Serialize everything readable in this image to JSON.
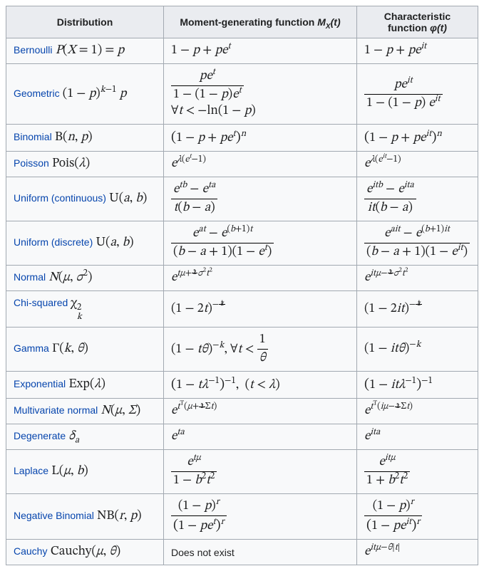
{
  "headers": {
    "dist": "Distribution",
    "mgf_pre": "Moment-generating function ",
    "mgf_sym": "M",
    "mgf_sub": "X",
    "mgf_arg": "(t)",
    "cf_pre": "Characteristic function ",
    "cf_sym": "φ(t)"
  },
  "rows": [
    {
      "link": "Bernoulli",
      "notation": " <span class='mi'>P</span>(<span class='mi'>X</span> = 1) = <span class='mi'>p</span>",
      "mgf": "1 − <span class='mi'>p</span> + <span class='mi'>p</span><span class='mi'>e</span><sup><span class='mi'>t</span></sup>",
      "cf": "1 − <span class='mi'>p</span> + <span class='mi'>p</span><span class='mi'>e</span><sup><span class='mi'>it</span></sup>"
    },
    {
      "link": "Geometric",
      "notation": " (1 − <span class='mi'>p</span>)<sup><span class='mi'>k</span>−1</sup> <span class='mi'>p</span>",
      "mgf": "<span class='frac'><span class='num'><span class='mi'>p</span><span class='mi'>e</span><sup><span class='mi'>t</span></sup></span><span class='den'>1 − (1 − <span class='mi'>p</span>)<span class='mi'>e</span><sup><span class='mi'>t</span></sup></span></span><br>∀<span class='mi'>t</span> &lt; −ln(1 − <span class='mi'>p</span>)",
      "cf": "<span class='frac'><span class='num'><span class='mi'>p</span><span class='mi'>e</span><sup><span class='mi'>it</span></sup></span><span class='den'>1 − (1 − <span class='mi'>p</span>) <span class='mi'>e</span><sup><span class='mi'>it</span></sup></span></span>"
    },
    {
      "link": "Binomial",
      "notation": " B(<span class='it'>n</span>, <span class='it'>p</span>)",
      "mgf": "<span class='bigp'>(</span>1 − <span class='mi'>p</span> + <span class='mi'>p</span><span class='mi'>e</span><sup><span class='mi'>t</span></sup><span class='bigp'>)</span><sup><span class='mi'>n</span></sup>",
      "cf": "<span class='bigp'>(</span>1 − <span class='mi'>p</span> + <span class='mi'>p</span><span class='mi'>e</span><sup><span class='mi'>it</span></sup><span class='bigp'>)</span><sup><span class='mi'>n</span></sup>"
    },
    {
      "link": "Poisson",
      "notation": " Pois(<span class='it'>λ</span>)",
      "mgf": "<span class='mi'>e</span><sup><span class='mi'>λ</span>(<span class='mi'>e</span><sup><span class='mi'>t</span></sup>−1)</sup>",
      "cf": "<span class='mi'>e</span><sup><span class='mi'>λ</span>(<span class='mi'>e</span><sup><span class='mi'>it</span></sup>−1)</sup>"
    },
    {
      "link": "Uniform (continuous)",
      "notation": " U(<span class='it'>a</span>, <span class='it'>b</span>)",
      "mgf": "<span class='frac'><span class='num'><span class='mi'>e</span><sup><span class='mi'>tb</span></sup> − <span class='mi'>e</span><sup><span class='mi'>ta</span></sup></span><span class='den'><span class='mi'>t</span>(<span class='mi'>b</span> − <span class='mi'>a</span>)</span></span>",
      "cf": "<span class='frac'><span class='num'><span class='mi'>e</span><sup><span class='mi'>itb</span></sup> − <span class='mi'>e</span><sup><span class='mi'>ita</span></sup></span><span class='den'><span class='mi'>it</span>(<span class='mi'>b</span> − <span class='mi'>a</span>)</span></span>"
    },
    {
      "link": "Uniform (discrete)",
      "notation": " U(<span class='it'>a</span>, <span class='it'>b</span>)",
      "mgf": "<span class='frac'><span class='num'><span class='mi'>e</span><sup><span class='mi'>at</span></sup> − <span class='mi'>e</span><sup>(<span class='mi'>b</span>+1)<span class='mi'>t</span></sup></span><span class='den'>(<span class='mi'>b</span> − <span class='mi'>a</span> + 1)(1 − <span class='mi'>e</span><sup><span class='mi'>t</span></sup>)</span></span>",
      "cf": "<span class='frac'><span class='num'><span class='mi'>e</span><sup><span class='mi'>ait</span></sup> − <span class='mi'>e</span><sup>(<span class='mi'>b</span>+1)<span class='mi'>it</span></sup></span><span class='den'>(<span class='mi'>b</span> − <span class='mi'>a</span> + 1)(1 − <span class='mi'>e</span><sup><span class='mi'>it</span></sup>)</span></span>"
    },
    {
      "link": "Normal",
      "notation": " <span class='it'>N</span>(<span class='it'>μ</span>, <span class='it'>σ</span><sup>2</sup>)",
      "mgf": "<span class='mi'>e</span><sup><span class='mi'>tμ</span>+<span class='sfrac'><span class='num'>1</span><span class='den'>2</span></span><span class='mi'>σ</span><sup>2</sup><span class='mi'>t</span><sup>2</sup></sup>",
      "cf": "<span class='mi'>e</span><sup><span class='mi'>itμ</span>−<span class='sfrac'><span class='num'>1</span><span class='den'>2</span></span><span class='mi'>σ</span><sup>2</sup><span class='mi'>t</span><sup>2</sup></sup>"
    },
    {
      "link": "Chi-squared",
      "notation": " χ<span class='subsup'><span class='su'>2</span><span class='su it'>k</span></span>",
      "mgf": "(1 − 2<span class='mi'>t</span>)<sup>−<span class='sfrac'><span class='num'><span class='mi'>k</span></span><span class='den'>2</span></span></sup>",
      "cf": "(1 − 2<span class='mi'>it</span>)<sup>−<span class='sfrac'><span class='num'><span class='mi'>k</span></span><span class='den'>2</span></span></sup>"
    },
    {
      "link": "Gamma",
      "notation": " Γ(<span class='it'>k</span>, <span class='it'>θ</span>)",
      "mgf": "(1 − <span class='mi'>tθ</span>)<sup>−<span class='mi'>k</span></sup>, ∀<span class='mi'>t</span> &lt; <span class='frac'><span class='num'>1</span><span class='den'><span class='mi'>θ</span></span></span>",
      "cf": "(1 − <span class='mi'>itθ</span>)<sup>−<span class='mi'>k</span></sup>"
    },
    {
      "link": "Exponential",
      "notation": " Exp(<span class='it'>λ</span>)",
      "mgf": "<span class='bigp'>(</span>1 − <span class='mi'>t</span><span class='mi'>λ</span><sup>−1</sup><span class='bigp'>)</span><sup>−1</sup>, &nbsp;(<span class='mi'>t</span> &lt; <span class='mi'>λ</span>)",
      "cf": "<span class='bigp'>(</span>1 − <span class='mi'>it</span><span class='mi'>λ</span><sup>−1</sup><span class='bigp'>)</span><sup>−1</sup>"
    },
    {
      "link": "Multivariate normal",
      "notation": " <span class='it'>N</span>(<span class='it'>μ</span>, <span class='it'>Σ</span>)",
      "mgf": "<span class='mi'>e</span><sup><span class='mi'>t</span><sup>T</sup>(<span class='mi'>μ</span>+<span class='sfrac'><span class='num'>1</span><span class='den'>2</span></span>Σ<span class='mi'>t</span>)</sup>",
      "cf": "<span class='mi'>e</span><sup><span class='mi'>t</span><sup>T</sup>(<span class='mi'>iμ</span>−<span class='sfrac'><span class='num'>1</span><span class='den'>2</span></span>Σ<span class='mi'>t</span>)</sup>"
    },
    {
      "link": "Degenerate",
      "notation": " <span class='it'>δ<sub>a</sub></span>",
      "mgf": "<span class='mi'>e</span><sup><span class='mi'>ta</span></sup>",
      "cf": "<span class='mi'>e</span><sup><span class='mi'>ita</span></sup>"
    },
    {
      "link": "Laplace",
      "notation": " L(<span class='it'>μ</span>, <span class='it'>b</span>)",
      "mgf": "<span class='frac'><span class='num'><span class='mi'>e</span><sup><span class='mi'>tμ</span></sup></span><span class='den'>1 − <span class='mi'>b</span><sup>2</sup><span class='mi'>t</span><sup>2</sup></span></span>",
      "cf": "<span class='frac'><span class='num'><span class='mi'>e</span><sup><span class='mi'>itμ</span></sup></span><span class='den'>1 + <span class='mi'>b</span><sup>2</sup><span class='mi'>t</span><sup>2</sup></span></span>"
    },
    {
      "link": "Negative Binomial",
      "notation": " NB(<span class='it'>r</span>, <span class='it'>p</span>)",
      "mgf": "<span class='frac'><span class='num'>(1 − <span class='mi'>p</span>)<sup><span class='mi'>r</span></sup></span><span class='den'><span class='bigp'>(</span>1 − <span class='mi'>p</span><span class='mi'>e</span><sup><span class='mi'>t</span></sup><span class='bigp'>)</span><sup><span class='mi'>r</span></sup></span></span>",
      "cf": "<span class='frac'><span class='num'>(1 − <span class='mi'>p</span>)<sup><span class='mi'>r</span></sup></span><span class='den'><span class='bigp'>(</span>1 − <span class='mi'>p</span><span class='mi'>e</span><sup><span class='mi'>it</span></sup><span class='bigp'>)</span><sup><span class='mi'>r</span></sup></span></span>"
    },
    {
      "link": "Cauchy",
      "notation": " Cauchy(<span class='it'>μ</span>, <span class='it'>θ</span>)",
      "mgf_plain": "Does not exist",
      "cf": "<span class='mi'>e</span><sup><span class='mi'>itμ</span>−<span class='mi'>θ</span>|<span class='mi'>t</span>|</sup>"
    }
  ]
}
